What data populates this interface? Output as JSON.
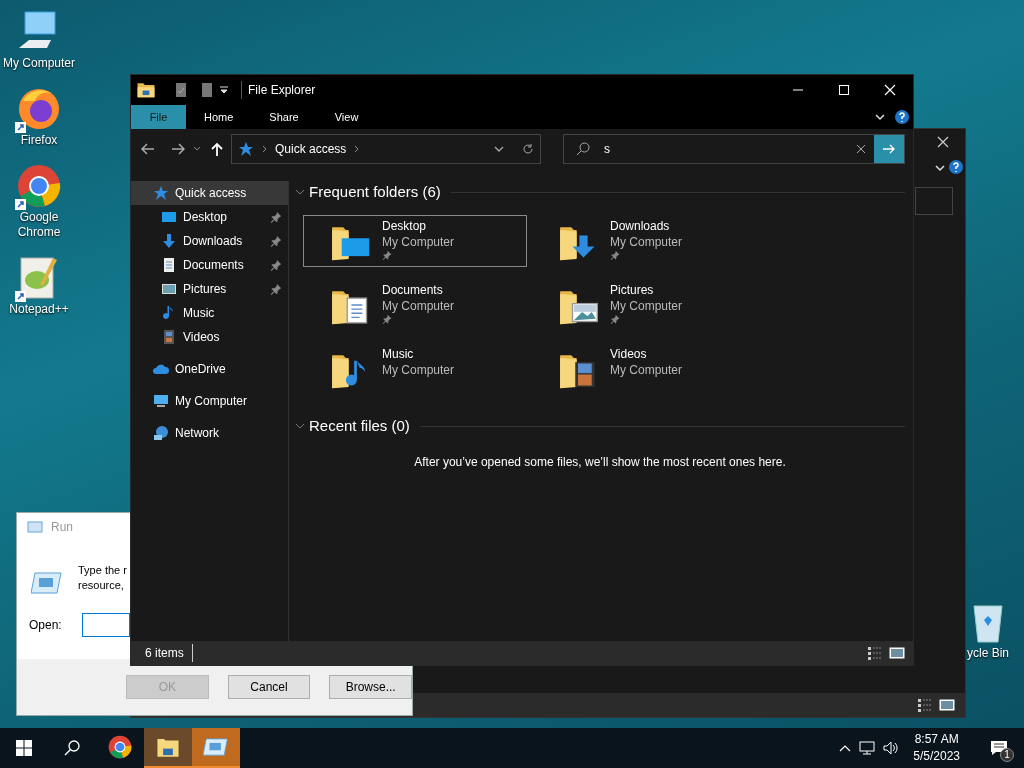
{
  "desktop_icons": [
    {
      "kind": "computer",
      "label": "My Computer",
      "shortcut": false
    },
    {
      "kind": "firefox",
      "label": "Firefox",
      "shortcut": true
    },
    {
      "kind": "chrome",
      "label": "Google Chrome",
      "shortcut": true
    },
    {
      "kind": "notepad",
      "label": "Notepad++",
      "shortcut": true
    }
  ],
  "recycle_bin": {
    "label": "ycle Bin"
  },
  "run_dialog": {
    "title": "Run",
    "description_lines": [
      "Type the r",
      "resource,"
    ],
    "open_label": "Open:",
    "buttons": [
      {
        "label": "OK",
        "disabled": true
      },
      {
        "label": "Cancel",
        "disabled": false
      },
      {
        "label": "Browse...",
        "disabled": false
      }
    ]
  },
  "explorer": {
    "title": "File Explorer",
    "ribbon_tabs": [
      {
        "label": "File",
        "selected": true
      },
      {
        "label": "Home",
        "selected": false
      },
      {
        "label": "Share",
        "selected": false
      },
      {
        "label": "View",
        "selected": false
      }
    ],
    "address": "Quick access",
    "search_value": "s",
    "sidebar": [
      {
        "kind": "quick",
        "label": "Quick access",
        "selected": true,
        "children": [
          {
            "kind": "desktop",
            "label": "Desktop",
            "pinned": true
          },
          {
            "kind": "downloads",
            "label": "Downloads",
            "pinned": true
          },
          {
            "kind": "documents",
            "label": "Documents",
            "pinned": true
          },
          {
            "kind": "pictures",
            "label": "Pictures",
            "pinned": true
          },
          {
            "kind": "music",
            "label": "Music",
            "pinned": false
          },
          {
            "kind": "videos",
            "label": "Videos",
            "pinned": false
          }
        ]
      },
      {
        "kind": "onedrive",
        "label": "OneDrive",
        "selected": false
      },
      {
        "kind": "computer",
        "label": "My Computer",
        "selected": false
      },
      {
        "kind": "network",
        "label": "Network",
        "selected": false
      }
    ],
    "frequent_heading": "Frequent folders (6)",
    "folders": [
      {
        "kind": "desktop",
        "name": "Desktop",
        "location": "My Computer",
        "pinned": true,
        "selected": true
      },
      {
        "kind": "downloads",
        "name": "Downloads",
        "location": "My Computer",
        "pinned": true,
        "selected": false
      },
      {
        "kind": "documents",
        "name": "Documents",
        "location": "My Computer",
        "pinned": true,
        "selected": false
      },
      {
        "kind": "pictures",
        "name": "Pictures",
        "location": "My Computer",
        "pinned": true,
        "selected": false
      },
      {
        "kind": "music",
        "name": "Music",
        "location": "My Computer",
        "pinned": false,
        "selected": false
      },
      {
        "kind": "videos",
        "name": "Videos",
        "location": "My Computer",
        "pinned": false,
        "selected": false
      }
    ],
    "recent_heading": "Recent files (0)",
    "recent_empty": "After you’ve opened some files, we’ll show the most recent ones here.",
    "status": "6 items"
  },
  "taskbar": {
    "apps": [
      {
        "kind": "chrome",
        "active": false
      },
      {
        "kind": "explorer",
        "active": true
      },
      {
        "kind": "run",
        "active": true
      }
    ],
    "time": "8:57 AM",
    "date": "5/5/2023",
    "notification_count": "1"
  }
}
